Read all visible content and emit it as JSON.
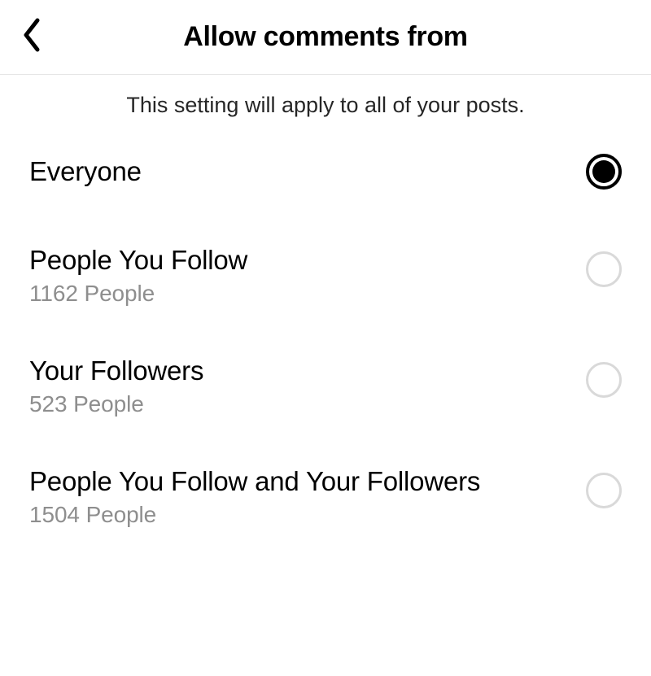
{
  "header": {
    "title": "Allow comments from"
  },
  "subtitle": "This setting will apply to all of your posts.",
  "options": [
    {
      "label": "Everyone",
      "sub": null,
      "selected": true
    },
    {
      "label": "People You Follow",
      "sub": "1162 People",
      "selected": false
    },
    {
      "label": "Your Followers",
      "sub": "523 People",
      "selected": false
    },
    {
      "label": "People You Follow and Your Followers",
      "sub": "1504 People",
      "selected": false
    }
  ]
}
